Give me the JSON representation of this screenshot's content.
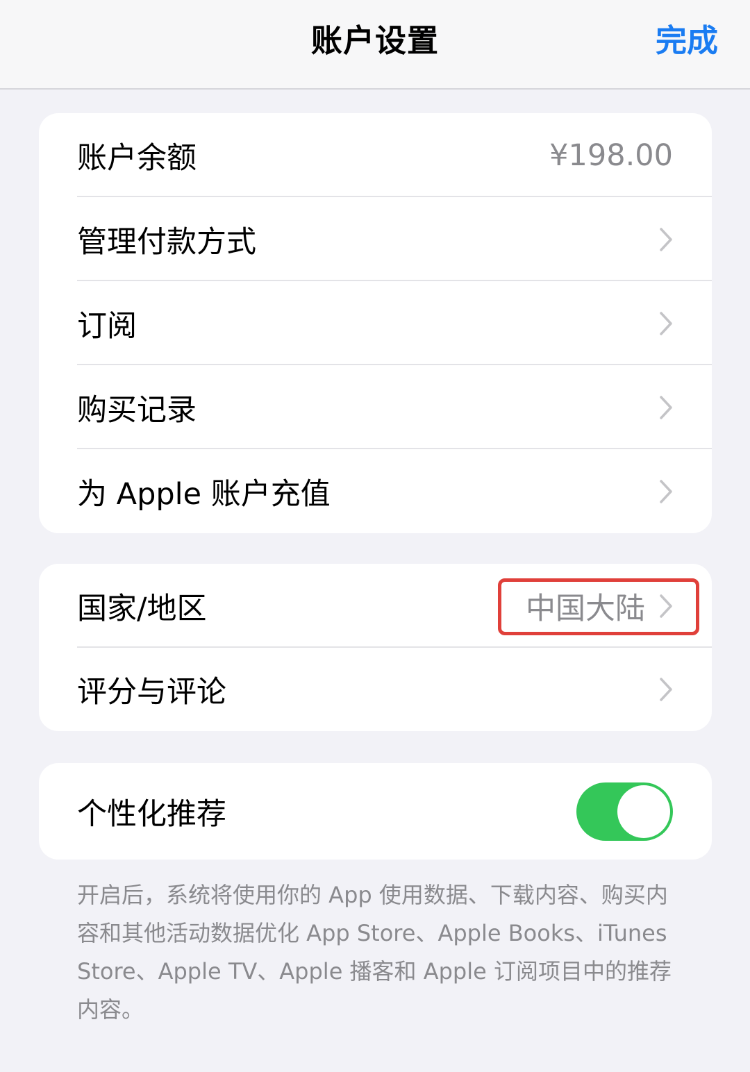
{
  "header": {
    "title": "账户设置",
    "done_label": "完成"
  },
  "group1": {
    "balance_label": "账户余额",
    "balance_value": "¥198.00",
    "payment_label": "管理付款方式",
    "subscriptions_label": "订阅",
    "purchase_history_label": "购买记录",
    "topup_label": "为 Apple 账户充值"
  },
  "group2": {
    "region_label": "国家/地区",
    "region_value": "中国大陆",
    "ratings_label": "评分与评论"
  },
  "group3": {
    "personalized_label": "个性化推荐",
    "personalized_on": true,
    "footnote": "开启后，系统将使用你的 App 使用数据、下载内容、购买内容和其他活动数据优化 App Store、Apple Books、iTunes Store、Apple TV、Apple 播客和 Apple 订阅项目中的推荐内容。"
  },
  "colors": {
    "accent": "#1a7cf2",
    "toggle_on": "#34c759",
    "highlight_box": "#e0403a",
    "background": "#f2f2f7"
  },
  "icons": [
    "chevron-right-icon"
  ]
}
